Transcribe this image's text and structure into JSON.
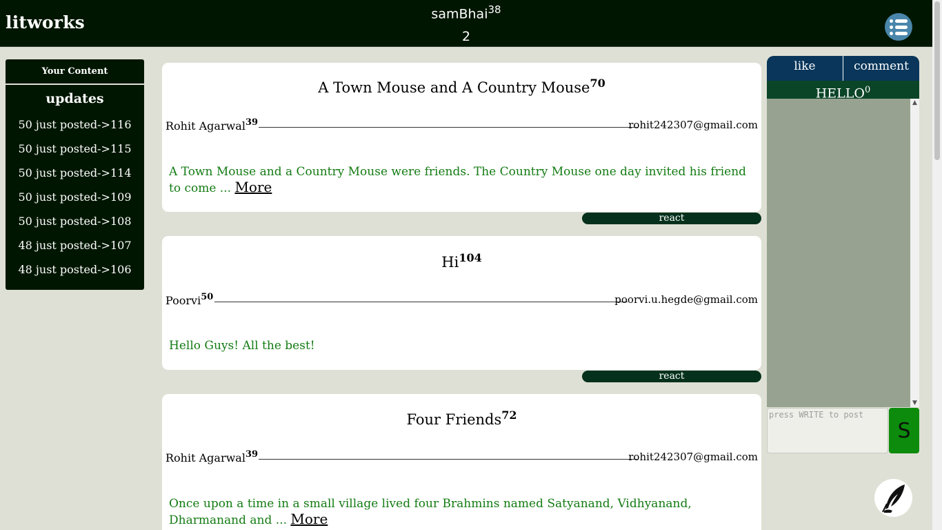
{
  "header": {
    "brand": "litworks",
    "username": "samBhai",
    "user_points": "38",
    "user_count": "2",
    "menu_icon": "list-icon"
  },
  "sidebar": {
    "your_content": "Your Content",
    "updates_title": "updates",
    "updates": [
      "50 just posted->116",
      "50 just posted->115",
      "50 just posted->114",
      "50 just posted->109",
      "50 just posted->108",
      "48 just posted->107",
      "48 just posted->106"
    ]
  },
  "posts": [
    {
      "title": "A Town Mouse and A Country Mouse",
      "title_score": "70",
      "author": "Rohit Agarwal",
      "author_score": "39",
      "email": "rohit242307@gmail.com",
      "excerpt": "A Town Mouse and a Country Mouse were friends. The Country Mouse one day invited his friend to come ...",
      "more_label": "More",
      "react_label": "react"
    },
    {
      "title": "Hi",
      "title_score": "104",
      "author": "Poorvi",
      "author_score": "50",
      "email": "poorvi.u.hegde@gmail.com",
      "excerpt": "Hello Guys! All the best!",
      "react_label": "react"
    },
    {
      "title": "Four Friends",
      "title_score": "72",
      "author": "Rohit Agarwal",
      "author_score": "39",
      "email": "rohit242307@gmail.com",
      "excerpt": "Once upon a time in a small village lived four Brahmins named Satyanand, Vidhyanand, Dharmanand and ...",
      "more_label": "More"
    }
  ],
  "right_panel": {
    "tab_like": "like",
    "tab_comment": "comment",
    "hello_title": "HELLO",
    "hello_count": "0",
    "input_placeholder": "press WRITE to post",
    "send_label": "S",
    "write_icon": "quill-icon"
  },
  "colors": {
    "header_bg": "#011600",
    "page_bg": "#dfe0d5",
    "post_text": "#137b13",
    "react_bg": "#05311c",
    "tabs_bg": "#09365a",
    "hello_bg": "#0b4528",
    "chat_bg": "#97a390",
    "send_bg": "#0d8b0d",
    "menu_bg": "#4a86ab"
  }
}
